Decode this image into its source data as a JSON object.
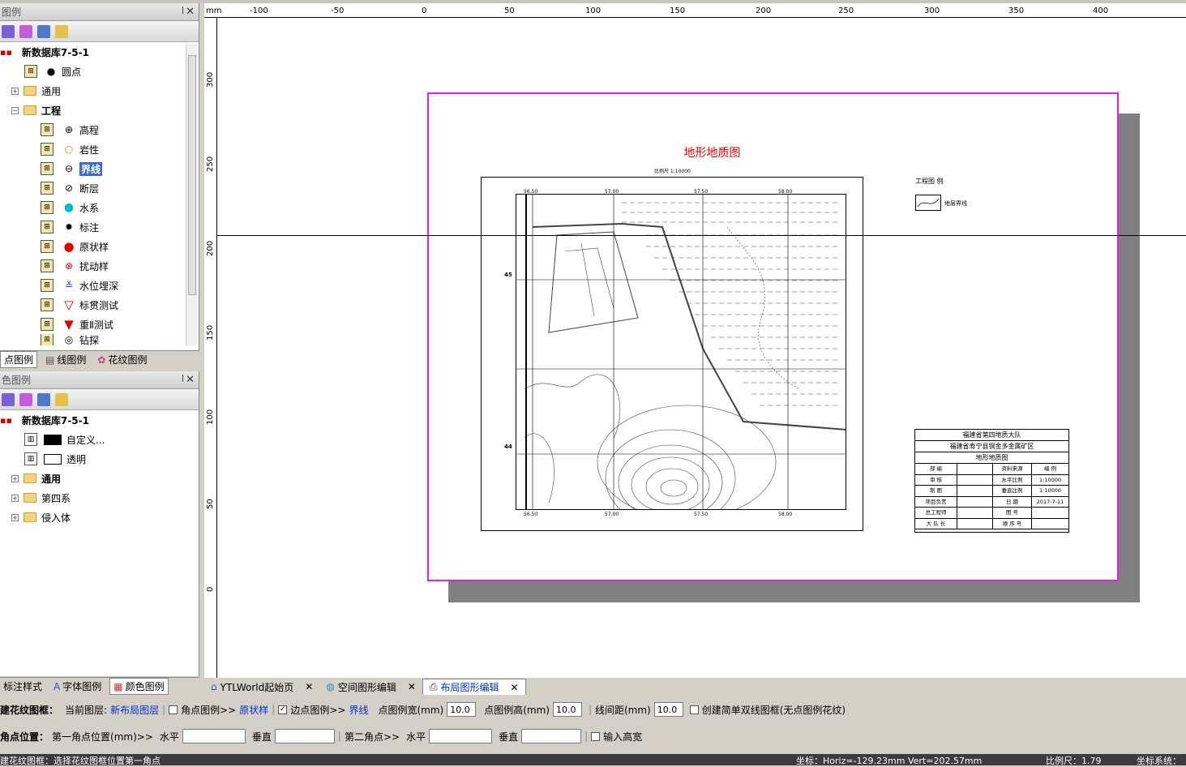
{
  "point_panel": {
    "title": "图例",
    "root": "新数据库7-5-1",
    "items": [
      "圆点",
      "通用",
      "工程",
      "高程",
      "岩性",
      "界线",
      "断层",
      "水系",
      "标注",
      "原状样",
      "扰动样",
      "水位埋深",
      "标贯测试",
      "重Ⅱ测试",
      "钻探"
    ],
    "tabs": [
      "点图例",
      "线图例",
      "花纹图例"
    ]
  },
  "color_panel": {
    "title": "色图例",
    "root": "新数据库7-5-1",
    "items": [
      "自定义...",
      "透明",
      "通用",
      "第四系",
      "侵入体"
    ],
    "tabs": [
      "标注样式",
      "字体图例",
      "颜色图例"
    ]
  },
  "ruler": {
    "unit": "mm",
    "h_labels": [
      "-100",
      "-50",
      "0",
      "50",
      "100",
      "150",
      "200",
      "250",
      "300",
      "350",
      "400"
    ],
    "v_labels": [
      "300",
      "250",
      "200",
      "150",
      "100",
      "50",
      "0"
    ]
  },
  "layout": {
    "map_title": "地形地质图",
    "scale_text": "比例尺  1:10000",
    "legend_title": "工程图    例",
    "legend_item": "地层界线",
    "grid_x": [
      "56.50",
      "57.00",
      "57.50",
      "58.00"
    ],
    "grid_y": [
      "45",
      "44"
    ],
    "title_block": {
      "r1": "福建省第四地质大队",
      "r2": "福建省寿宁县铜金多金属矿区",
      "r3": "地形地质图",
      "rows": [
        [
          "部 编",
          "",
          "资料来源",
          "编 例"
        ],
        [
          "审 核",
          "",
          "水平比例",
          "1:10000"
        ],
        [
          "制 图",
          "",
          "垂直比例",
          "1:10000"
        ],
        [
          "项目负责",
          "",
          "日 期",
          "2017-7-11"
        ],
        [
          "总工程师",
          "",
          "图 号",
          ""
        ],
        [
          "大 队 长",
          "",
          "顺 序 号",
          ""
        ]
      ]
    }
  },
  "doc_tabs": [
    "YTLWorld起始页",
    "空间图形编辑",
    "布局图形编辑"
  ],
  "frame_bar": {
    "title": "建花纹图框：",
    "cur_layer_label": "当前图层:",
    "cur_layer": "新布局图层",
    "corner_label": "角点图例>>",
    "corner_value": "原状样",
    "edge_label": "边点图例>>",
    "edge_value": "界线",
    "w_label": "点图例宽(mm)",
    "w_value": "10.0",
    "h_label": "点图例高(mm)",
    "h_value": "10.0",
    "gap_label": "线间距(mm)",
    "gap_value": "10.0",
    "simple_label": "创建简单双线图框(无点图例花纹)"
  },
  "corner_bar": {
    "title": "角点位置：",
    "first": "第一角点位置(mm)>>",
    "h": "水平",
    "v": "垂直",
    "second": "第二角点>>",
    "h2": "水平",
    "v2": "垂直",
    "input_wh": "输入高宽"
  },
  "status": {
    "left": "建花纹图框：选择花纹图框位置第一角点",
    "coord": "坐标：Horiz=-129.23mm  Vert=202.57mm",
    "scale": "比例尺：1.79",
    "system": "坐标系统："
  }
}
